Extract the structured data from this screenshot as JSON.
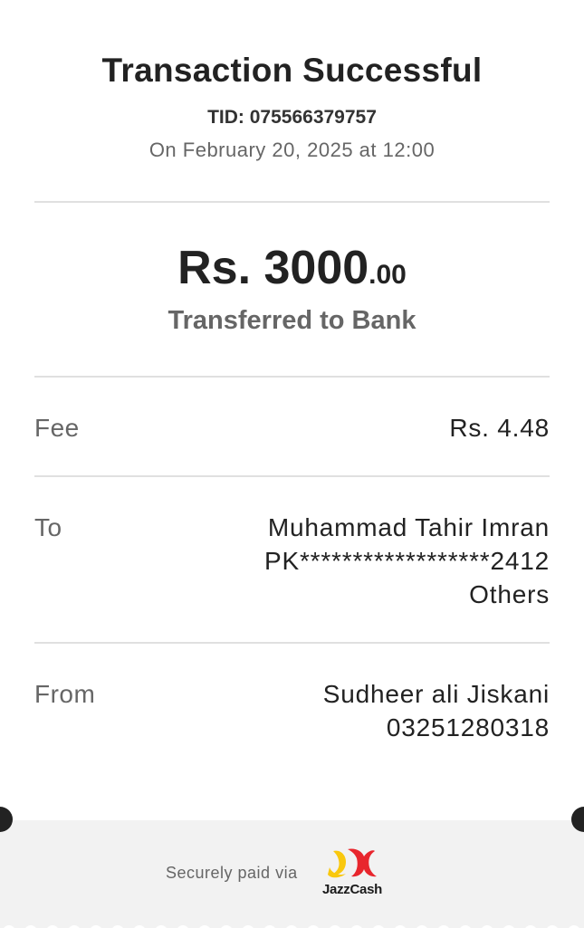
{
  "header": {
    "title": "Transaction Successful",
    "tid": "TID: 075566379757",
    "date": "On February 20, 2025 at 12:00"
  },
  "amount": {
    "main": "Rs. 3000",
    "cents": ".00",
    "type": "Transferred to Bank"
  },
  "fee": {
    "label": "Fee",
    "value": "Rs. 4.48"
  },
  "to": {
    "label": "To",
    "name": "Muhammad Tahir Imran",
    "account": "PK******************2412",
    "bank": "Others"
  },
  "from": {
    "label": "From",
    "name": "Sudheer ali Jiskani",
    "number": "03251280318"
  },
  "footer": {
    "paid_via": "Securely paid via",
    "brand": "JazzCash",
    "brand_colors": {
      "yellow": "#f9c80e",
      "red": "#e8262d"
    }
  }
}
